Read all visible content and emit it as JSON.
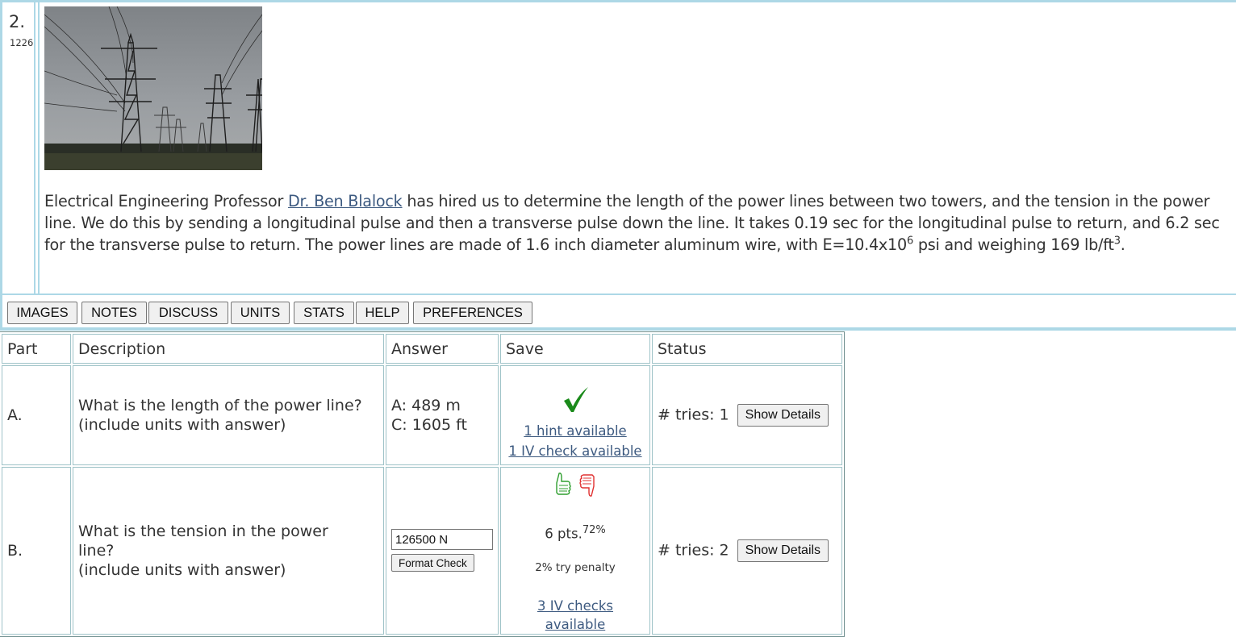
{
  "problem": {
    "number": "2.",
    "id": "1226",
    "image_alt": "power-line-towers-photo",
    "text_before_link": "Electrical Engineering Professor ",
    "link_text": "Dr. Ben Blalock",
    "text_after_link": " has hired us to determine the length of the power lines between two towers, and the tension in the power line. We do this by sending a longitudinal pulse and then a transverse pulse down the line. It takes 0.19 sec for the longitudinal pulse to return, and 6.2 sec for the transverse pulse to return. The power lines are made of 1.6 inch diameter aluminum wire, with E=10.4x10",
    "exp1": "6",
    "text_mid": " psi and weighing 169 lb/ft",
    "exp2": "3",
    "text_end": "."
  },
  "toolbar": {
    "buttons": [
      "IMAGES",
      "NOTES",
      "DISCUSS",
      "UNITS",
      "STATS",
      "HELP",
      "PREFERENCES"
    ]
  },
  "table": {
    "headers": [
      "Part",
      "Description",
      "Answer",
      "Save",
      "Status"
    ],
    "rows": [
      {
        "part": "A.",
        "description_line1": "What is the length of the power line?",
        "description_line2": "(include units with answer)",
        "answer_line1": "A: 489 m",
        "answer_line2": "C: 1605 ft",
        "save_icon": "checkmark-icon",
        "hint_link": "1 hint available",
        "iv_link": "1 IV check available",
        "status": "# tries: 1",
        "details_button": "Show Details"
      },
      {
        "part": "B.",
        "description_line1": "What is the tension in the power",
        "description_line2": "line?",
        "description_line3": "(include units with answer)",
        "answer_value": "126500 N",
        "format_check": "Format Check",
        "save_icons": [
          "thumbs-up-icon",
          "thumbs-down-icon"
        ],
        "points": "6 pts.",
        "percent": "72%",
        "penalty": "2% try penalty",
        "iv_link": "3 IV checks available",
        "status": "# tries: 2",
        "details_button": "Show Details"
      }
    ]
  },
  "colors": {
    "frame": "#add8e6",
    "link": "#3d5a80",
    "correct": "#1a8a1a",
    "thumb_up": "#2e9e2e",
    "thumb_down": "#e03030"
  }
}
